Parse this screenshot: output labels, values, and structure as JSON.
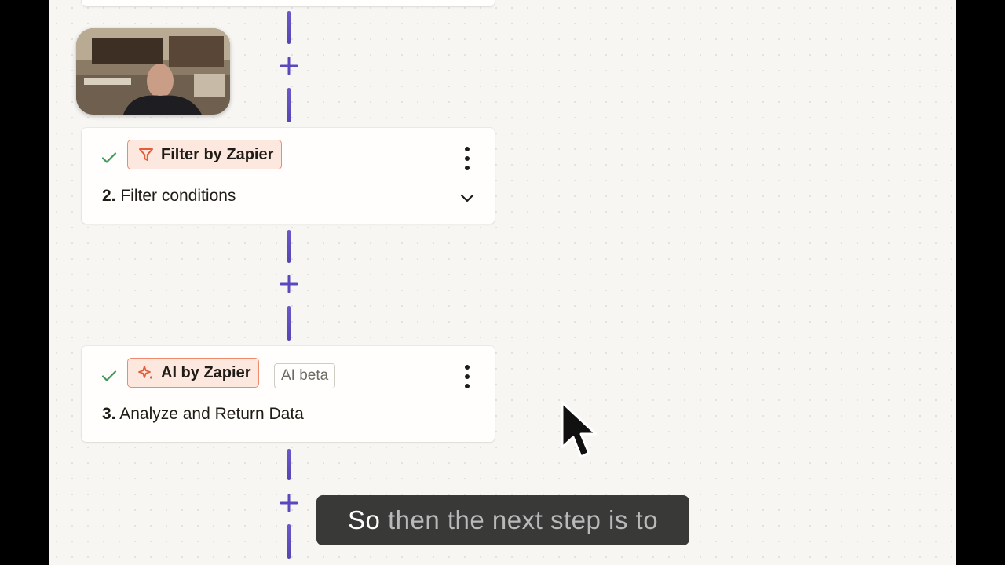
{
  "colors": {
    "accent": "#5a48bd",
    "check": "#3f9a5a",
    "chip_bg": "#fde8df",
    "chip_border": "#ef8a6a",
    "canvas_bg": "#f7f6f3"
  },
  "steps": [
    {
      "app_label": "Filter by Zapier",
      "app_icon": "filter-icon",
      "number": "2.",
      "title": "Filter conditions",
      "status_icon": "check-icon",
      "menu_icon": "more-vertical-icon",
      "expand_icon": "chevron-down-icon"
    },
    {
      "app_label": "AI by Zapier",
      "app_icon": "ai-sparkle-icon",
      "badge": "AI beta",
      "number": "3.",
      "title": "Analyze and Return Data",
      "status_icon": "check-icon",
      "menu_icon": "more-vertical-icon"
    }
  ],
  "add_step_icon": "plus-icon",
  "caption": {
    "highlighted": "So",
    "rest": " then the next step is to"
  }
}
